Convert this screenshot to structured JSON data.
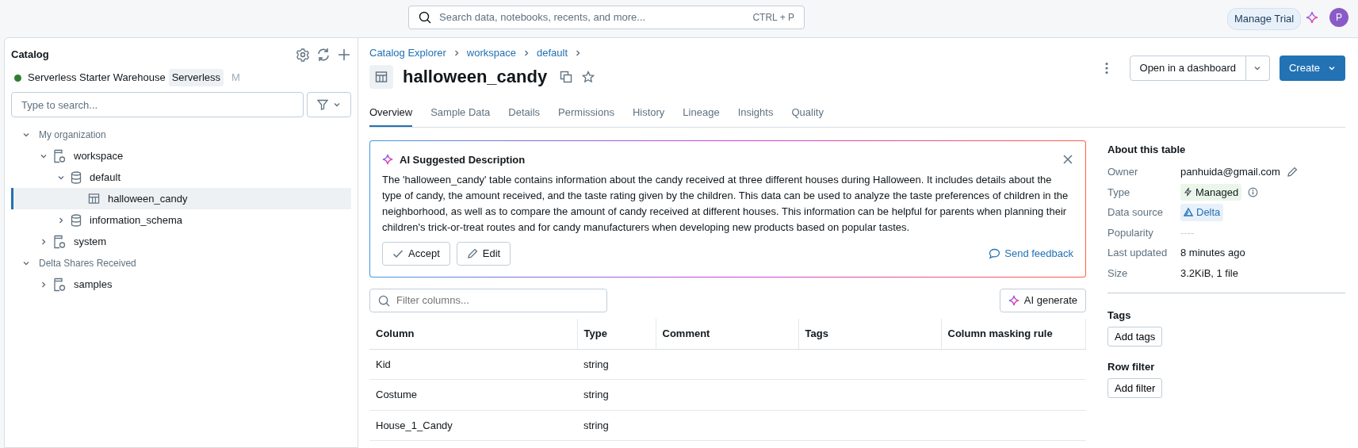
{
  "top_bar": {
    "search": {
      "placeholder": "Search data, notebooks, recents, and more...",
      "shortcut": "CTRL + P"
    },
    "manage_trial": "Manage Trial",
    "avatar": "P"
  },
  "sidebar": {
    "title": "Catalog",
    "warehouse": {
      "name": "Serverless Starter Warehouse",
      "tag": "Serverless",
      "size": "M",
      "color": "#2f7d32"
    },
    "search": {
      "placeholder": "Type to search..."
    },
    "tree": [
      {
        "label": "My organization",
        "kind": "group",
        "expanded": true,
        "selected": false,
        "children": [
          {
            "label": "workspace",
            "kind": "catalog",
            "expanded": true,
            "selected": false,
            "children": [
              {
                "label": "default",
                "kind": "schema",
                "expanded": true,
                "selected": false,
                "children": [
                  {
                    "label": "halloween_candy",
                    "kind": "table",
                    "selected": true
                  }
                ]
              },
              {
                "label": "information_schema",
                "kind": "schema",
                "expanded": false,
                "selected": false
              }
            ]
          },
          {
            "label": "system",
            "kind": "catalog",
            "expanded": false,
            "selected": false
          }
        ]
      },
      {
        "label": "Delta Shares Received",
        "kind": "group",
        "expanded": true,
        "selected": false,
        "children": [
          {
            "label": "samples",
            "kind": "catalog",
            "expanded": false,
            "selected": false
          }
        ]
      }
    ]
  },
  "breadcrumb": [
    "Catalog Explorer",
    "workspace",
    "default"
  ],
  "title": "halloween_candy",
  "actions": {
    "open": "Open in a dashboard",
    "create": "Create"
  },
  "tabs": [
    {
      "label": "Overview",
      "selected": true
    },
    {
      "label": "Sample Data",
      "selected": false
    },
    {
      "label": "Details",
      "selected": false
    },
    {
      "label": "Permissions",
      "selected": false
    },
    {
      "label": "History",
      "selected": false
    },
    {
      "label": "Lineage",
      "selected": false
    },
    {
      "label": "Insights",
      "selected": false
    },
    {
      "label": "Quality",
      "selected": false
    }
  ],
  "ai_description": {
    "title": "AI Suggested Description",
    "text": "The 'halloween_candy' table contains information about the candy received at three different houses during Halloween. It includes details about the type of candy, the amount received, and the taste rating given by the children. This data can be used to analyze the taste preferences of children in the neighborhood, as well as to compare the amount of candy received at different houses. This information can be helpful for parents when planning their children's trick-or-treat routes and for candy manufacturers when developing new products based on popular tastes.",
    "accept": "Accept",
    "edit": "Edit",
    "feedback": "Send feedback"
  },
  "filter": {
    "placeholder": "Filter columns..."
  },
  "ai_generate": "AI generate",
  "table": {
    "columns": [
      "Column",
      "Type",
      "Comment",
      "Tags",
      "Column masking rule"
    ],
    "rows": [
      [
        "Kid",
        "string"
      ],
      [
        "Costume",
        "string"
      ],
      [
        "House_1_Candy",
        "string"
      ]
    ]
  },
  "about": {
    "title": "About this table",
    "properties": [
      {
        "label": "Owner",
        "value": "panhuida@gmail.com",
        "kind": "owner"
      },
      {
        "label": "Type",
        "value": "Managed",
        "kind": "managed"
      },
      {
        "label": "Data source",
        "value": "Delta",
        "kind": "delta"
      },
      {
        "label": "Popularity",
        "value": "----",
        "kind": "muted"
      },
      {
        "label": "Last updated",
        "value": "8 minutes ago",
        "kind": "text"
      },
      {
        "label": "Size",
        "value": "3.2KiB, 1 file",
        "kind": "text"
      }
    ]
  },
  "tags": {
    "title": "Tags",
    "button": "Add tags"
  },
  "row_filter": {
    "title": "Row filter",
    "button": "Add filter"
  }
}
